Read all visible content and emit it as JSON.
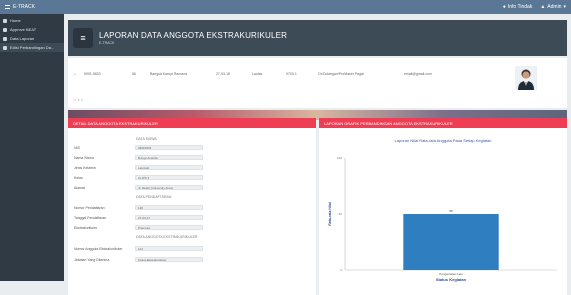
{
  "topbar": {
    "brand": "E-TRACK",
    "notif": "Info Tindak",
    "user": "Admin"
  },
  "sidebar": {
    "items": [
      {
        "label": "Home",
        "icon": "home-icon"
      },
      {
        "label": "Approve BEAT",
        "icon": "check-icon"
      },
      {
        "label": "Data Laporan",
        "icon": "folder-icon"
      },
      {
        "label": "Edisi Perbandingan Da...",
        "icon": "chart-icon"
      }
    ]
  },
  "header": {
    "title": "LAPORAN DATA ANGGOTA EKSTRAKURIKULER",
    "subtitle": "E-TRACK"
  },
  "filter": {
    "cells": [
      "9901-5803",
      "56",
      "Bangsa Karupi Ramana",
      "27-03-18",
      "Laulas",
      "9703-1",
      "Or/Cidangan/ProMaker Pagal",
      "email@gmail.com"
    ],
    "pager": "< 1 >"
  },
  "left": {
    "title": "Detail Data Anggota Ekstrakurikuler",
    "section1": "DATA SISWA",
    "rows1": [
      {
        "label": "NIS",
        "value": "99015803"
      },
      {
        "label": "Nama Siswa",
        "value": "Bunga Ananda"
      },
      {
        "label": "Jenis Kelamin",
        "value": "Laki-laki"
      },
      {
        "label": "Kelas",
        "value": "XI-IPS 2"
      },
      {
        "label": "Alamat",
        "value": "Jl. Melati (University Area)"
      }
    ],
    "section2": "DATA PENDAFTARAN",
    "rows2": [
      {
        "label": "Nomor Pendaftaran",
        "value": "118"
      },
      {
        "label": "Tanggal Pendaftaran",
        "value": "27-03-17"
      },
      {
        "label": "Ekstrakurikuler",
        "value": "Pramuka"
      }
    ],
    "section3": "DATA ANGGOTA EKSTRAKURIKULER",
    "rows3": [
      {
        "label": "Nomor Anggota Ekstrakurikuler",
        "value": "121"
      },
      {
        "label": "Jabatan Yang Diterima",
        "value": "Ketua Ekstrakurikuler"
      }
    ]
  },
  "right": {
    "title": "Laporan Grafik Perbandingan Anggota Ekstrakurikuler"
  },
  "chart_data": {
    "type": "bar",
    "title": "Laporan Nilai Rata-rata Anggota Pada Setiap Kegiatan",
    "categories": [
      "Pengamatan Lain"
    ],
    "values": [
      50
    ],
    "data_labels": [
      "50"
    ],
    "xlabel": "Status Kegiatan",
    "ylabel": "Rata-rata Nilai",
    "yticks": [
      "0",
      "50",
      "100"
    ],
    "ylim": [
      0,
      100
    ],
    "bar_color": "#2f7ec0",
    "grid": false
  },
  "colors": {
    "accent": "#ef3e54",
    "header": "#3d4b57",
    "sidebar": "#2f3a44",
    "topbar": "#5a7895"
  }
}
